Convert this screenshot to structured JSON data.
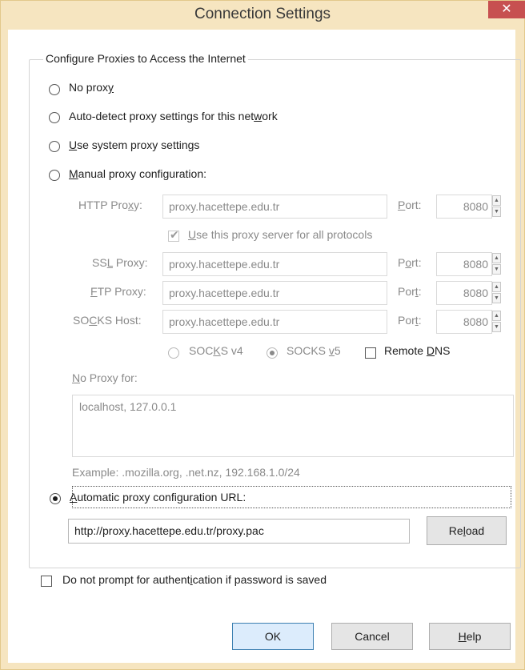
{
  "window": {
    "title": "Connection Settings",
    "close_glyph": "✕",
    "colors": {
      "frame": "#f6e5c0",
      "close": "#c75050"
    }
  },
  "group": {
    "legend": "Configure Proxies to Access the Internet"
  },
  "radios": [
    {
      "pre": "No prox",
      "u": "y",
      "post": "",
      "checked": false
    },
    {
      "pre": "Auto-detect proxy settings for this net",
      "u": "w",
      "post": "ork",
      "checked": false
    },
    {
      "pre": "",
      "u": "U",
      "post": "se system proxy settings",
      "checked": false
    },
    {
      "pre": "",
      "u": "M",
      "post": "anual proxy configuration:",
      "checked": false
    }
  ],
  "manual": {
    "http": {
      "pre": "HTTP Pro",
      "u": "x",
      "post": "y:",
      "value": "proxy.hacettepe.edu.tr",
      "port": "8080"
    },
    "port_label": {
      "pre": "",
      "u": "P",
      "post": "ort:"
    },
    "port_label_n": {
      "pre": "P",
      "u": "o",
      "post": "rt:"
    },
    "port_label_t": {
      "pre": "Por",
      "u": "t",
      "post": ":"
    },
    "use_all": {
      "pre": "",
      "u": "U",
      "post": "se this proxy server for all protocols",
      "checked": true
    },
    "ssl": {
      "pre": "SS",
      "u": "L",
      "post": " Proxy:",
      "value": "proxy.hacettepe.edu.tr",
      "port": "8080"
    },
    "ftp": {
      "pre": "",
      "u": "F",
      "post": "TP Proxy:",
      "value": "proxy.hacettepe.edu.tr",
      "port": "8080"
    },
    "socks": {
      "pre": "SO",
      "u": "C",
      "post": "KS Host:",
      "value": "proxy.hacettepe.edu.tr",
      "port": "8080"
    },
    "socks_v4": {
      "pre": "SOC",
      "u": "K",
      "post": "S v4",
      "checked": false
    },
    "socks_v5": {
      "pre": "SOCKS ",
      "u": "v",
      "post": "5",
      "checked": true
    },
    "remote_dns": {
      "pre": "Remote ",
      "u": "D",
      "post": "NS",
      "checked": false
    },
    "no_proxy_label": {
      "pre": "",
      "u": "N",
      "post": "o Proxy for:"
    },
    "no_proxy_value": "localhost, 127.0.0.1",
    "example": "Example: .mozilla.org, .net.nz, 192.168.1.0/24"
  },
  "auto_url": {
    "pre": "",
    "u": "A",
    "post": "utomatic proxy configuration URL:",
    "checked": true,
    "value": "http://proxy.hacettepe.edu.tr/proxy.pac",
    "reload": {
      "pre": "Re",
      "u": "l",
      "post": "oad"
    }
  },
  "no_prompt": {
    "pre": "Do not prompt for authent",
    "u": "i",
    "post": "cation if password is saved",
    "checked": false
  },
  "buttons": {
    "ok": "OK",
    "cancel": "Cancel",
    "help": {
      "pre": "",
      "u": "H",
      "post": "elp"
    }
  }
}
